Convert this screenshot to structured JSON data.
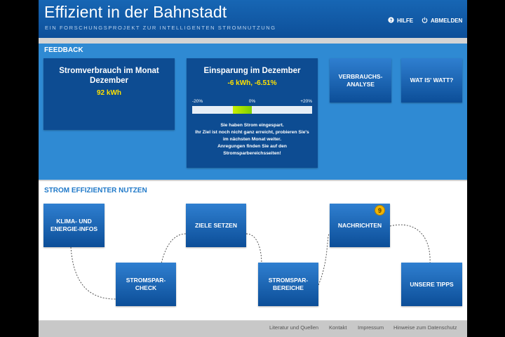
{
  "header": {
    "title": "Effizient in der Bahnstadt",
    "subtitle": "EIN FORSCHUNGSPROJEKT ZUR INTELLIGENTEN STROMNUTZUNG",
    "help_label": "HILFE",
    "logout_label": "ABMELDEN",
    "help_icon": "question-circle-icon",
    "logout_icon": "power-icon"
  },
  "feedback": {
    "title": "FEEDBACK",
    "consumption": {
      "title": "Stromverbrauch im Monat Dezember",
      "value": "92 kWh"
    },
    "savings": {
      "title": "Einsparung im Dezember",
      "value": "-6 kWh, -6.51%",
      "scale_min_label": "-20%",
      "scale_mid_label": "0%",
      "scale_max_label": "+20%",
      "scale_min": -20,
      "scale_max": 20,
      "bar_value": -6.51,
      "message": [
        "Sie haben Strom eingespart.",
        "Ihr Ziel ist noch nicht ganz erreicht, probieren Sie's",
        "im nächsten Monat weiter.",
        "Anregungen finden Sie auf den",
        "Stromsparbereichsseiten!"
      ]
    },
    "analysis_label": "VERBRAUCHS-\nANALYSE",
    "watt_label": "WAT IS' WATT?"
  },
  "efficient": {
    "title": "STROM EFFIZIENTER NUTZEN",
    "tiles": {
      "klima": "KLIMA- UND\nENERGIE-INFOS",
      "check": "STROMSPAR-\nCHECK",
      "ziele": "ZIELE SETZEN",
      "bereiche": "STROMSPAR-\nBEREICHE",
      "nachrichten": "NACHRICHTEN",
      "tipps": "UNSERE TIPPS"
    },
    "message_count": "9"
  },
  "footer": {
    "links": [
      "Literatur und Quellen",
      "Kontakt",
      "Impressum",
      "Hinweise zum Datenschutz"
    ]
  },
  "colors": {
    "primary": "#0d4c92",
    "accent_yellow": "#ffe100",
    "feedback_bg": "#2f8ad3",
    "badge": "#f0b400"
  }
}
